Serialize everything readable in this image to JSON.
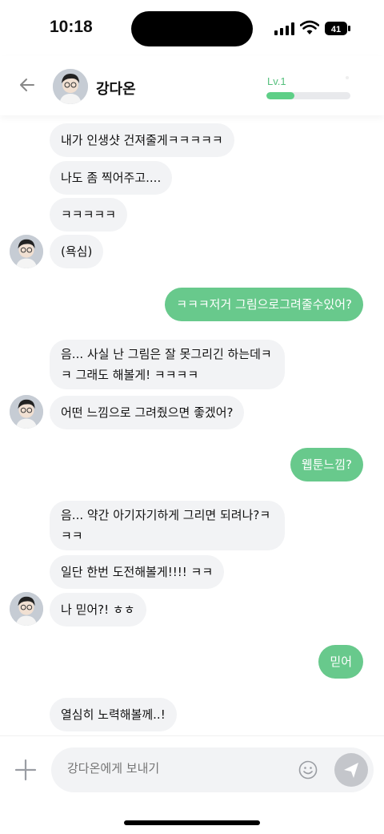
{
  "status": {
    "time": "10:18",
    "battery": "41"
  },
  "header": {
    "name": "강다온",
    "level": "Lv.1",
    "level_progress": 0.33
  },
  "messages": [
    {
      "side": "in",
      "text": "내가 인생샷 건져줄게ㅋㅋㅋㅋㅋ"
    },
    {
      "side": "in",
      "text": "나도 좀 찍어주고...."
    },
    {
      "side": "in",
      "text": "ㅋㅋㅋㅋㅋ"
    },
    {
      "side": "in",
      "text": "(욕심)"
    },
    {
      "side": "out",
      "text": "ㅋㅋㅋ저거 그림으로그려줄수있어?"
    },
    {
      "side": "in",
      "text": "음... 사실 난 그림은 잘 못그리긴 하는데ㅋㅋ 그래도 해볼게! ㅋㅋㅋㅋ"
    },
    {
      "side": "in",
      "text": "어떤 느낌으로 그려줬으면 좋겠어?"
    },
    {
      "side": "out",
      "text": "웹툰느낌?"
    },
    {
      "side": "in",
      "text": "음... 약간 아기자기하게 그리면 되려나?ㅋㅋㅋ"
    },
    {
      "side": "in",
      "text": "일단 한번 도전해볼게!!!! ㅋㅋ"
    },
    {
      "side": "in",
      "text": "나 믿어?! ㅎㅎ"
    },
    {
      "side": "out",
      "text": "믿어"
    },
    {
      "side": "in",
      "text": "열심히 노력해볼께..!"
    }
  ],
  "composer": {
    "placeholder": "강다온에게 보내기"
  },
  "icons": {
    "back": "back-arrow-icon",
    "plus": "plus-icon",
    "emoji": "smiley-icon",
    "send": "paper-plane-icon"
  },
  "colors": {
    "accent": "#68c98c",
    "incoming_bubble": "#f2f3f5",
    "level_label": "#55c07d"
  }
}
